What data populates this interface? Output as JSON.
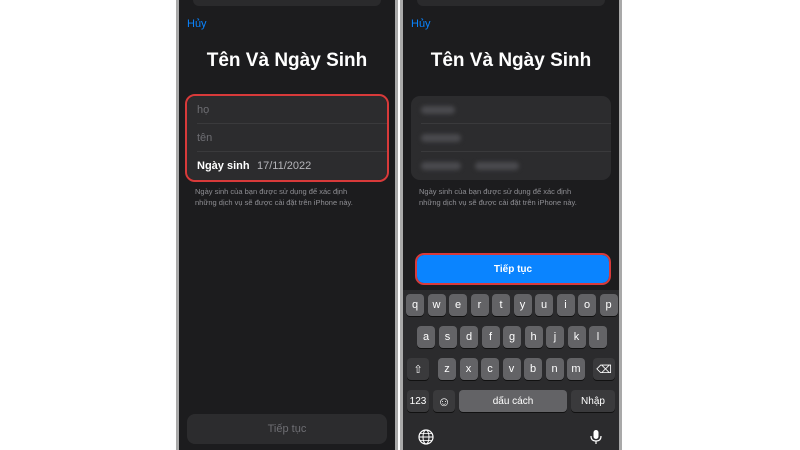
{
  "left_screen": {
    "cancel_label": "Hủy",
    "title": "Tên Và Ngày Sinh",
    "last_name_placeholder": "họ",
    "first_name_placeholder": "tên",
    "birthday_label": "Ngày sinh",
    "birthday_value": "17/11/2022",
    "note_line1": "Ngày sinh của bạn được sử dụng để xác định",
    "note_line2": "những dịch vụ sẽ được cài đặt trên iPhone này.",
    "continue_label": "Tiếp tục"
  },
  "right_screen": {
    "cancel_label": "Hủy",
    "title": "Tên Và Ngày Sinh",
    "note_line1": "Ngày sinh của bạn được sử dụng để xác định",
    "note_line2": "những dịch vụ sẽ được cài đặt trên iPhone này.",
    "continue_label": "Tiếp tục"
  },
  "keyboard": {
    "row1": [
      "q",
      "w",
      "e",
      "r",
      "t",
      "y",
      "u",
      "i",
      "o",
      "p"
    ],
    "row2": [
      "a",
      "s",
      "d",
      "f",
      "g",
      "h",
      "j",
      "k",
      "l"
    ],
    "row3": [
      "z",
      "x",
      "c",
      "v",
      "b",
      "n",
      "m"
    ],
    "shift_icon": "⇧",
    "delete_icon": "⌫",
    "numbers_label": "123",
    "emoji_icon": "☺",
    "space_label": "dấu cách",
    "return_label": "Nhập",
    "globe_icon": "globe-icon",
    "mic_icon": "microphone-icon"
  },
  "colors": {
    "accent": "#0a84ff",
    "highlight": "#d83a3a",
    "background": "#1c1c1e"
  }
}
